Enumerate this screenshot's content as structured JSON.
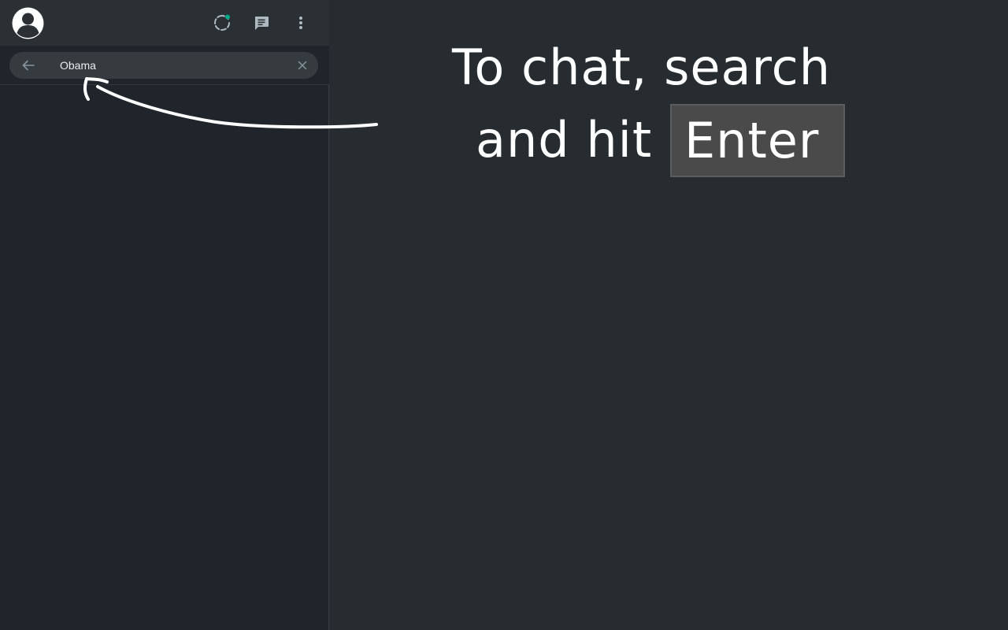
{
  "sidebar": {
    "header": {
      "avatar_icon": "default-user-avatar-icon",
      "status_icon": "status-ring-icon",
      "new_chat_icon": "new-chat-icon",
      "menu_icon": "more-vertical-icon",
      "status_dot_color": "#00a884"
    },
    "search": {
      "value": "Obama",
      "back_icon": "arrow-left-icon",
      "clear_icon": "close-icon"
    }
  },
  "main": {
    "hint": {
      "line1": "To chat, search",
      "line2": "and hit",
      "key_label": "Enter"
    }
  },
  "colors": {
    "sidebar_bg": "#20252c",
    "header_bg": "#2b3034",
    "search_bg": "#363b3f",
    "main_bg": "#262c30",
    "key_bg": "#4a4a4a",
    "accent": "#00a884"
  }
}
